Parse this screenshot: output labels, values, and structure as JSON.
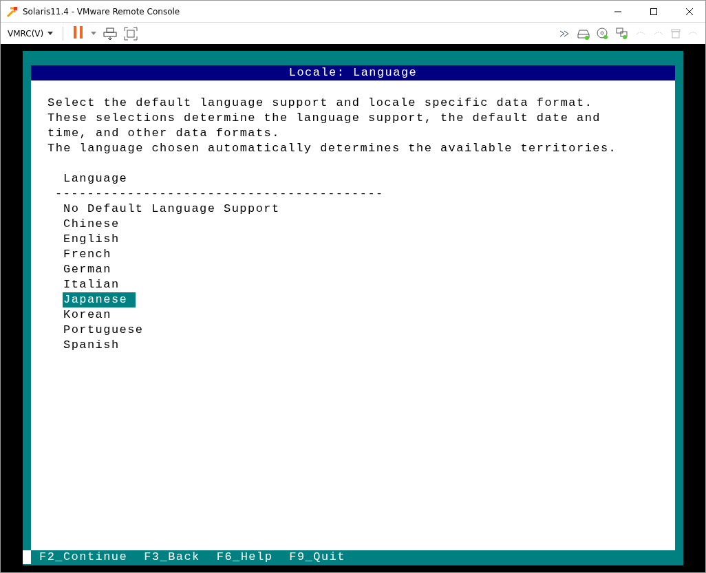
{
  "window": {
    "title": "Solaris11.4 - VMware Remote Console"
  },
  "toolbar": {
    "menu": "VMRC(V)",
    "paused": true
  },
  "screen": {
    "title": "Locale: Language",
    "description": [
      "Select the default language support and locale specific data format.",
      "These selections determine the language support, the default date and",
      "time, and other data formats.",
      "The language chosen automatically determines the available territories."
    ],
    "column_header": "Language",
    "separator": "-----------------------------------------",
    "languages": [
      {
        "label": "No Default Language Support",
        "selected": false
      },
      {
        "label": "Chinese",
        "selected": false
      },
      {
        "label": "English",
        "selected": false
      },
      {
        "label": "French",
        "selected": false
      },
      {
        "label": "German",
        "selected": false
      },
      {
        "label": "Italian",
        "selected": false
      },
      {
        "label": "Japanese",
        "selected": true
      },
      {
        "label": "Korean",
        "selected": false
      },
      {
        "label": "Portuguese",
        "selected": false
      },
      {
        "label": "Spanish",
        "selected": false
      }
    ],
    "function_keys": [
      "F2_Continue",
      "F3_Back",
      "F6_Help",
      "F9_Quit"
    ]
  }
}
